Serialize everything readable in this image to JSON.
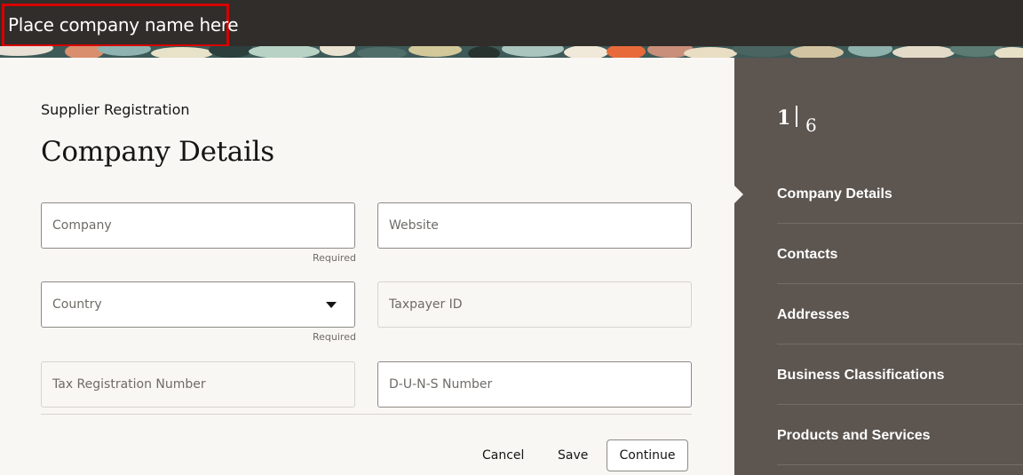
{
  "header": {
    "company_name": "Place company name here"
  },
  "form": {
    "eyebrow": "Supplier Registration",
    "title": "Company Details",
    "fields": {
      "company": {
        "placeholder": "Company",
        "note": "Required"
      },
      "website": {
        "placeholder": "Website"
      },
      "country": {
        "placeholder": "Country",
        "note": "Required"
      },
      "taxpayer_id": {
        "placeholder": "Taxpayer ID"
      },
      "tax_registration_number": {
        "placeholder": "Tax Registration Number"
      },
      "duns_number": {
        "placeholder": "D-U-N-S Number"
      }
    },
    "actions": {
      "cancel": "Cancel",
      "save": "Save",
      "continue": "Continue"
    }
  },
  "steps": {
    "current": "1",
    "total": "6",
    "items": [
      {
        "label": "Company Details"
      },
      {
        "label": "Contacts"
      },
      {
        "label": "Addresses"
      },
      {
        "label": "Business Classifications"
      },
      {
        "label": "Products and Services"
      }
    ]
  },
  "colors": {
    "topbar": "#312d2a",
    "highlight_border": "#d60000",
    "side_panel": "#5c5550",
    "page_background": "#f9f7f4"
  }
}
